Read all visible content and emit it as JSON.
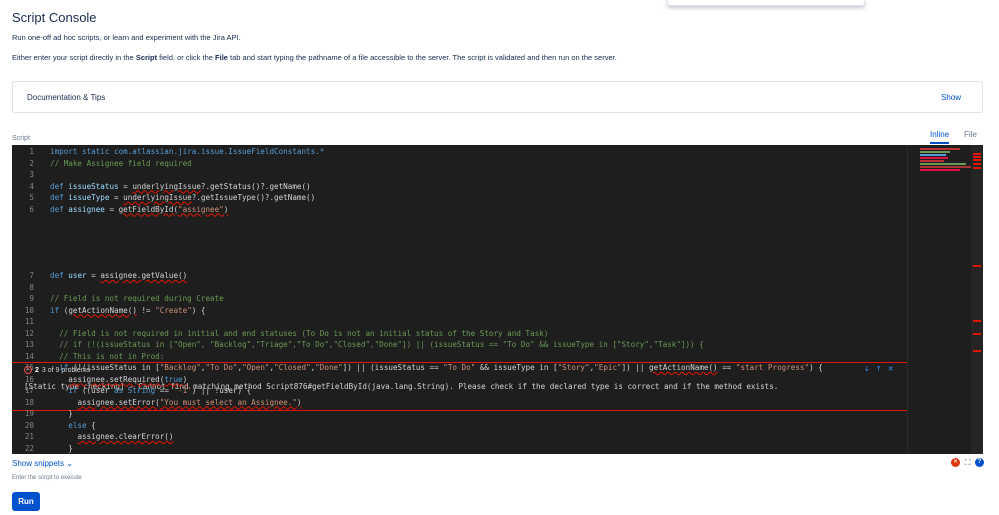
{
  "page": {
    "title": "Script Console",
    "description_1": "Run one-off ad hoc scripts, or learn and experiment with the Jira API.",
    "description_2_parts": [
      "Either enter your script directly in the ",
      "Script",
      " field, or click the ",
      "File",
      " tab and start typing the pathname of a file accessible to the server. The script is validated and then run on the server."
    ]
  },
  "documentation": {
    "title": "Documentation & Tips",
    "show_label": "Show"
  },
  "script_field": {
    "label": "Script",
    "tabs": [
      {
        "label": "Inline",
        "active": true
      },
      {
        "label": "File",
        "active": false
      }
    ]
  },
  "editor": {
    "lines_before_zone": [
      {
        "num": "1",
        "segments": [
          {
            "t": "import static com.atlassian.jira.issue.IssueFieldConstants.*",
            "c": "kw"
          }
        ]
      },
      {
        "num": "2",
        "segments": [
          {
            "t": "// Make Assignee field required",
            "c": "cm"
          }
        ]
      },
      {
        "num": "3",
        "segments": []
      },
      {
        "num": "4",
        "segments": [
          {
            "t": "def ",
            "c": "kw"
          },
          {
            "t": "issueStatus",
            "c": "id"
          },
          {
            "t": " = ",
            "c": "pl"
          },
          {
            "t": "underlyingIssue",
            "c": "pl",
            "sq": true
          },
          {
            "t": "?.getStatus()?.getName()",
            "c": "pl"
          }
        ]
      },
      {
        "num": "5",
        "segments": [
          {
            "t": "def ",
            "c": "kw"
          },
          {
            "t": "issueType",
            "c": "id"
          },
          {
            "t": " = ",
            "c": "pl"
          },
          {
            "t": "underlyingIssue",
            "c": "pl",
            "sq": true
          },
          {
            "t": "?.getIssueType()?.getName()",
            "c": "pl"
          }
        ]
      },
      {
        "num": "6",
        "segments": [
          {
            "t": "def ",
            "c": "kw"
          },
          {
            "t": "assignee",
            "c": "id"
          },
          {
            "t": " = ",
            "c": "pl"
          },
          {
            "t": "getFieldById(",
            "c": "pl",
            "sq": true
          },
          {
            "t": "\"assignee\"",
            "c": "st",
            "sq": true
          },
          {
            "t": ")",
            "c": "pl",
            "sq": true
          }
        ]
      }
    ],
    "problem_zone": {
      "count": "2",
      "of_label": "3 of 9 problems",
      "message": "[Static type checking] - Cannot find matching method Script876#getFieldById(java.lang.String). Please check if the declared type is correct and if the method exists."
    },
    "lines_after_zone": [
      {
        "num": "7",
        "segments": [
          {
            "t": "def ",
            "c": "kw"
          },
          {
            "t": "user",
            "c": "id"
          },
          {
            "t": " = ",
            "c": "pl"
          },
          {
            "t": "assignee.getValue()",
            "c": "pl",
            "sq": true
          }
        ]
      },
      {
        "num": "8",
        "segments": []
      },
      {
        "num": "9",
        "segments": [
          {
            "t": "// Field is not required during Create",
            "c": "cm"
          }
        ]
      },
      {
        "num": "10",
        "segments": [
          {
            "t": "if",
            "c": "kw"
          },
          {
            "t": " (",
            "c": "pl"
          },
          {
            "t": "getActionName()",
            "c": "pl",
            "sq": true
          },
          {
            "t": " != ",
            "c": "pl"
          },
          {
            "t": "\"Create\"",
            "c": "st"
          },
          {
            "t": ") {",
            "c": "pl"
          }
        ]
      },
      {
        "num": "11",
        "segments": []
      },
      {
        "num": "12",
        "segments": [
          {
            "t": "  // Field is not required in initial and end statuses (To Do is not an initial status of the Story and Task)",
            "c": "cm"
          }
        ]
      },
      {
        "num": "13",
        "segments": [
          {
            "t": "  // if (!(issueStatus in [\"Open\", \"Backlog\",\"Triage\",\"To Do\",\"Closed\",\"Done\"]) || (issueStatus == \"To Do\" && issueType in [\"Story\",\"Task\"])) {",
            "c": "cm"
          }
        ]
      },
      {
        "num": "14",
        "segments": [
          {
            "t": "  // This is not in Prod:",
            "c": "cm"
          }
        ]
      },
      {
        "num": "15",
        "segments": [
          {
            "t": "  if",
            "c": "kw"
          },
          {
            "t": " (!(issueStatus in [",
            "c": "pl"
          },
          {
            "t": "\"Backlog\"",
            "c": "st"
          },
          {
            "t": ",",
            "c": "pl"
          },
          {
            "t": "\"To Do\"",
            "c": "st"
          },
          {
            "t": ",",
            "c": "pl"
          },
          {
            "t": "\"Open\"",
            "c": "st"
          },
          {
            "t": ",",
            "c": "pl"
          },
          {
            "t": "\"Closed\"",
            "c": "st"
          },
          {
            "t": ",",
            "c": "pl"
          },
          {
            "t": "\"Done\"",
            "c": "st"
          },
          {
            "t": "]) || (issueStatus == ",
            "c": "pl"
          },
          {
            "t": "\"To Do\"",
            "c": "st"
          },
          {
            "t": " && issueType in [",
            "c": "pl"
          },
          {
            "t": "\"Story\"",
            "c": "st"
          },
          {
            "t": ",",
            "c": "pl"
          },
          {
            "t": "\"Epic\"",
            "c": "st"
          },
          {
            "t": "]) || ",
            "c": "pl"
          },
          {
            "t": "getActionName()",
            "c": "pl",
            "sq": true
          },
          {
            "t": " == ",
            "c": "pl"
          },
          {
            "t": "\"start Progress\"",
            "c": "st"
          },
          {
            "t": ") {",
            "c": "pl"
          }
        ]
      },
      {
        "num": "16",
        "segments": [
          {
            "t": "    ",
            "c": "pl"
          },
          {
            "t": "assignee.setRequired(",
            "c": "pl",
            "sq": true
          },
          {
            "t": "true",
            "c": "kw",
            "sq": true
          },
          {
            "t": ")",
            "c": "pl",
            "sq": true
          }
        ]
      },
      {
        "num": "17",
        "segments": [
          {
            "t": "    if",
            "c": "kw"
          },
          {
            "t": " ((user ",
            "c": "pl"
          },
          {
            "t": "as String",
            "c": "kw"
          },
          {
            "t": " == ",
            "c": "pl"
          },
          {
            "t": "'-1'",
            "c": "st"
          },
          {
            "t": ") || !user) {",
            "c": "pl"
          }
        ]
      },
      {
        "num": "18",
        "segments": [
          {
            "t": "      ",
            "c": "pl"
          },
          {
            "t": "assignee.setError(",
            "c": "pl",
            "sq": true
          },
          {
            "t": "\"You must select an Assignee.\"",
            "c": "st",
            "sq": true
          },
          {
            "t": ")",
            "c": "pl",
            "sq": true
          }
        ]
      },
      {
        "num": "19",
        "segments": [
          {
            "t": "    }",
            "c": "pl"
          }
        ]
      },
      {
        "num": "20",
        "segments": [
          {
            "t": "    else",
            "c": "kw"
          },
          {
            "t": " {",
            "c": "pl"
          }
        ]
      },
      {
        "num": "21",
        "segments": [
          {
            "t": "      ",
            "c": "pl"
          },
          {
            "t": "assignee.clearError()",
            "c": "pl",
            "sq": true
          }
        ]
      },
      {
        "num": "22",
        "segments": [
          {
            "t": "    }",
            "c": "pl"
          }
        ]
      }
    ]
  },
  "colors": {
    "accent": "#0052cc",
    "error": "#e51400",
    "editor_bg": "#1e1e1e"
  },
  "below_editor": {
    "show_snippets_label": "Show snippets",
    "hint": "Enter the script to execute",
    "run_label": "Run"
  }
}
